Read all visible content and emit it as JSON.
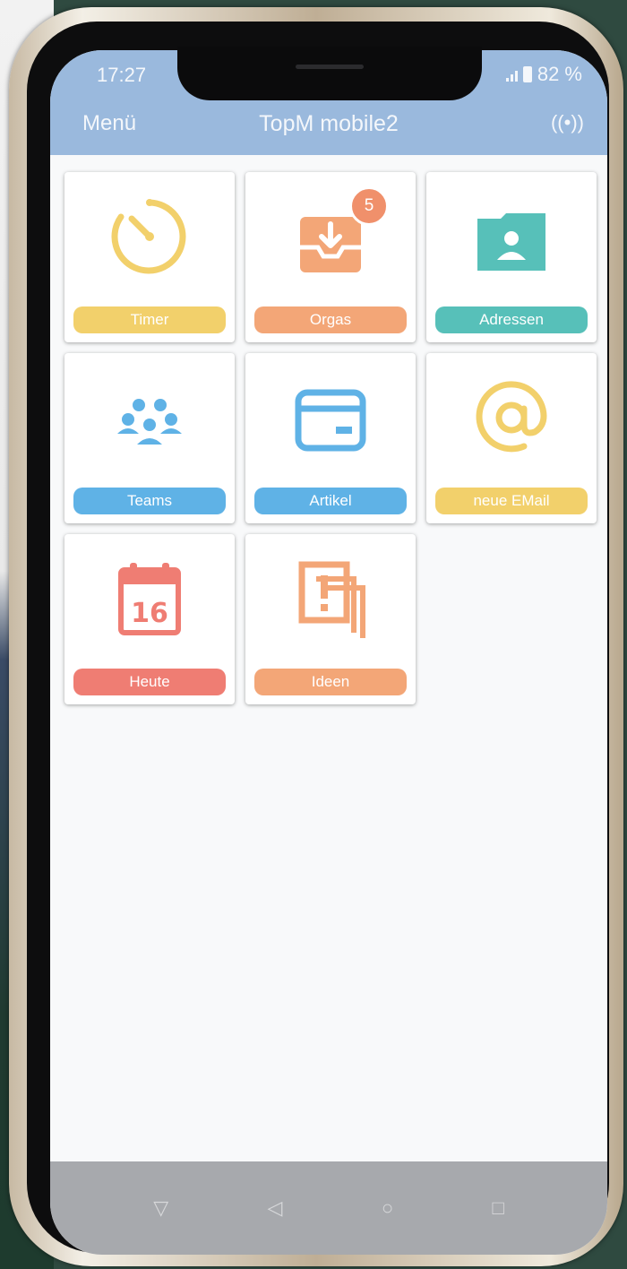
{
  "status": {
    "time": "17:27",
    "battery": "82 %"
  },
  "nav": {
    "menu": "Menü",
    "title": "TopM mobile2",
    "broadcast": "((•))"
  },
  "tiles": [
    {
      "label": "Timer",
      "icon": "stopwatch-icon",
      "color": "#f2d06b"
    },
    {
      "label": "Orgas",
      "icon": "inbox-download-icon",
      "color": "#f3a677",
      "badge": "5"
    },
    {
      "label": "Adressen",
      "icon": "contact-folder-icon",
      "color": "#57c0b9"
    },
    {
      "label": "Teams",
      "icon": "team-people-icon",
      "color": "#5fb2e6"
    },
    {
      "label": "Artikel",
      "icon": "box-icon",
      "color": "#5fb2e6"
    },
    {
      "label": "neue EMail",
      "icon": "at-icon",
      "color": "#f2d06b"
    },
    {
      "label": "Heute",
      "icon": "calendar-icon",
      "color": "#ef7d73",
      "date": "16"
    },
    {
      "label": "Ideen",
      "icon": "ideas-icon",
      "color": "#f3a677"
    }
  ],
  "bottom_nav": {
    "down": "▽",
    "back": "◁",
    "home": "○",
    "recent": "□"
  }
}
